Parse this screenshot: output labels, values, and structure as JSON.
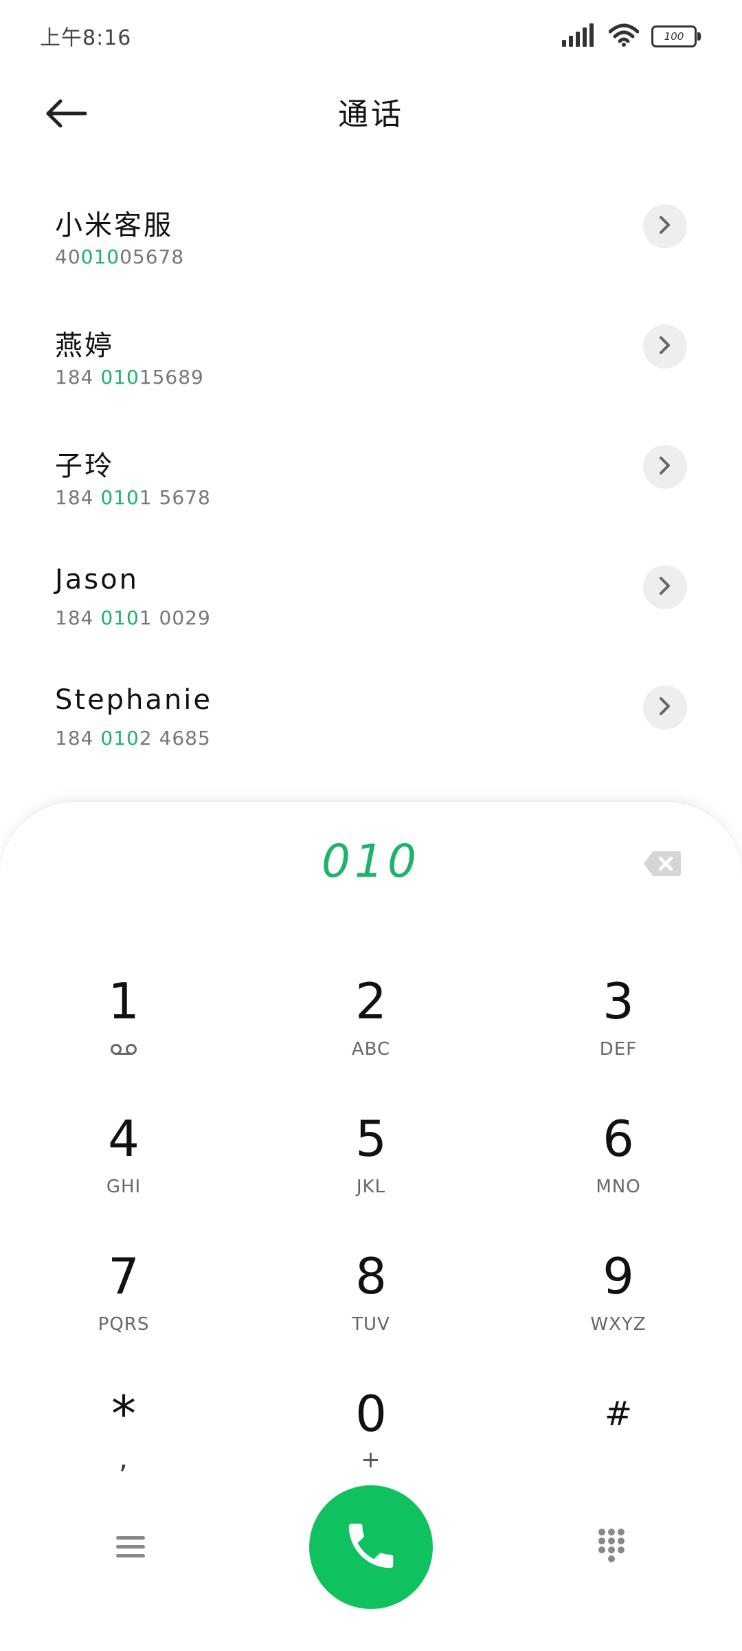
{
  "status_bar": {
    "time": "上午8:16",
    "battery": "100",
    "icons": [
      "signal-icon",
      "wifi-icon",
      "battery-icon"
    ]
  },
  "header": {
    "title": "通话",
    "back_icon": "back-arrow-icon"
  },
  "contacts": [
    {
      "name": "小米客服",
      "number_parts": [
        "40",
        "010",
        "05678"
      ]
    },
    {
      "name": "燕婷",
      "number_parts": [
        "184 ",
        "010",
        "15689"
      ]
    },
    {
      "name": "子玲",
      "number_parts": [
        "184 ",
        "010",
        "1 5678"
      ]
    },
    {
      "name": "Jason",
      "number_parts": [
        "184 ",
        "010",
        "1 0029"
      ]
    },
    {
      "name": "Stephanie",
      "number_parts": [
        "184 ",
        "010",
        "2 4685"
      ]
    }
  ],
  "dialer": {
    "input": "010",
    "backspace_icon": "backspace-icon",
    "keys": [
      {
        "digit": "1",
        "letters": "",
        "icon": "voicemail-icon"
      },
      {
        "digit": "2",
        "letters": "ABC"
      },
      {
        "digit": "3",
        "letters": "DEF"
      },
      {
        "digit": "4",
        "letters": "GHI"
      },
      {
        "digit": "5",
        "letters": "JKL"
      },
      {
        "digit": "6",
        "letters": "MNO"
      },
      {
        "digit": "7",
        "letters": "PQRS"
      },
      {
        "digit": "8",
        "letters": "TUV"
      },
      {
        "digit": "9",
        "letters": "WXYZ"
      },
      {
        "digit": "*",
        "letters": ","
      },
      {
        "digit": "0",
        "letters": "+"
      },
      {
        "digit": "#",
        "letters": ""
      }
    ]
  },
  "bottom_bar": {
    "menu_icon": "menu-icon",
    "call_icon": "phone-icon",
    "keypad_icon": "keypad-icon"
  },
  "colors": {
    "accent_green": "#1db36a",
    "call_green": "#10c15f",
    "chevron_bg": "#eeeeee"
  }
}
